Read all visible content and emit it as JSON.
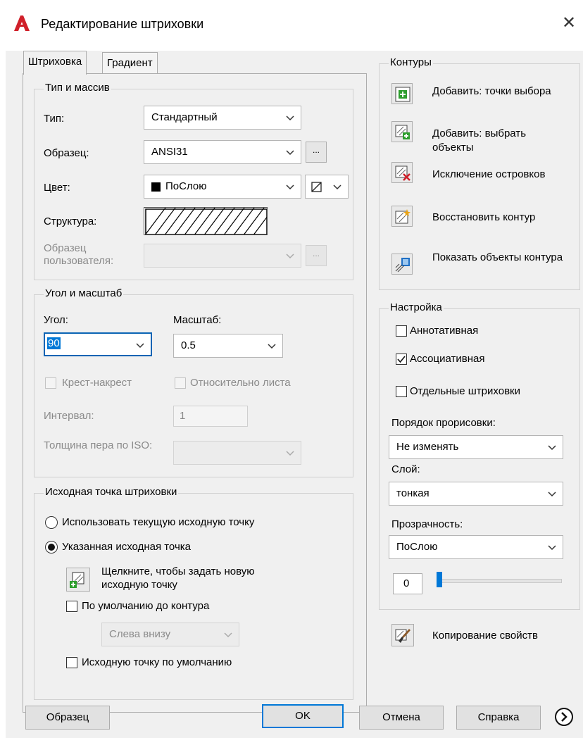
{
  "window": {
    "title": "Редактирование штриховки",
    "close_label": "✕"
  },
  "tabs": [
    {
      "label": "Штриховка",
      "active": true
    },
    {
      "label": "Градиент",
      "active": false
    }
  ],
  "type_group": {
    "title": "Тип и массив",
    "type_label": "Тип:",
    "type_value": "Стандартный",
    "pattern_label": "Образец:",
    "pattern_value": "ANSI31",
    "pattern_browse": "...",
    "color_label": "Цвет:",
    "color_value": "ПоСлою",
    "color_swatch": "#000000",
    "swatch_label": "Структура:",
    "custom_label": "Образец пользователя:",
    "custom_browse": "..."
  },
  "angle_group": {
    "title": "Угол и масштаб",
    "angle_label": "Угол:",
    "angle_value": "90",
    "scale_label": "Масштаб:",
    "scale_value": "0.5",
    "double_label": "Крест-накрест",
    "double_checked": false,
    "relative_label": "Относительно листа",
    "relative_checked": false,
    "spacing_label": "Интервал:",
    "spacing_value": "1",
    "iso_label": "Толщина пера по ISO:"
  },
  "origin_group": {
    "title": "Исходная точка штриховки",
    "use_current_label": "Использовать текущую исходную точку",
    "specified_label": "Указанная исходная точка",
    "click_label": "Щелкните, чтобы задать новую исходную точку",
    "default_boundary_label": "По умолчанию до контура",
    "default_boundary_checked": false,
    "position_value": "Слева внизу",
    "store_default_label": "Исходную точку по умолчанию",
    "store_default_checked": false
  },
  "boundaries": {
    "title": "Контуры",
    "add_pick_label": "Добавить: точки выбора",
    "add_select_label": "Добавить: выбрать объекты",
    "remove_islands_label": "Исключение островков",
    "recreate_label": "Восстановить контур",
    "display_label": "Показать объекты контура"
  },
  "options": {
    "title": "Настройка",
    "annotative_label": "Аннотативная",
    "annotative_checked": false,
    "associative_label": "Ассоциативная",
    "associative_checked": true,
    "separate_label": "Отдельные штриховки",
    "separate_checked": false,
    "draw_order_label": "Порядок прорисовки:",
    "draw_order_value": "Не изменять",
    "layer_label": "Слой:",
    "layer_value": "тонкая",
    "transparency_label": "Прозрачность:",
    "transparency_value": "ПоСлою",
    "transparency_number": "0",
    "transparency_level": 0
  },
  "inherit_label": "Копирование свойств",
  "footer": {
    "preview_label": "Образец",
    "ok_label": "OK",
    "cancel_label": "Отмена",
    "help_label": "Справка"
  },
  "colors": {
    "accent": "#0078d7",
    "logo": "#d0202a"
  }
}
